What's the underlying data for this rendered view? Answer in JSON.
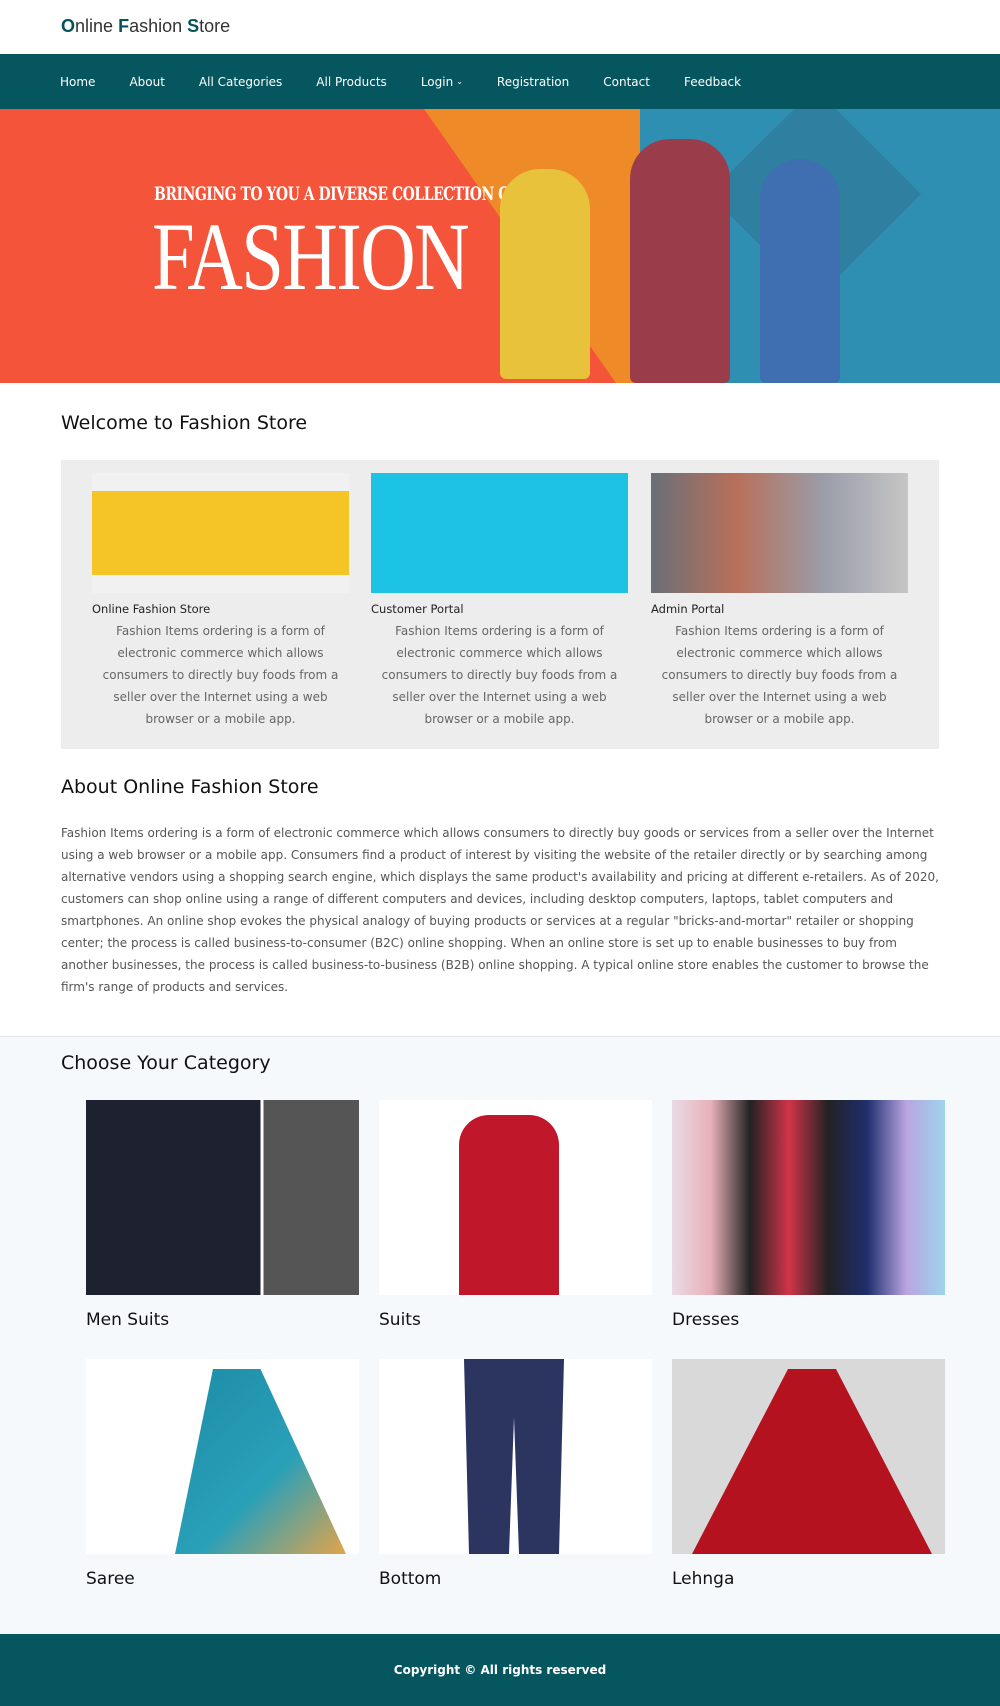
{
  "header": {
    "brand": "Online Fashion Store"
  },
  "nav": {
    "items": [
      "Home",
      "About",
      "All Categories",
      "All Products",
      "Login",
      "Registration",
      "Contact",
      "Feedback"
    ]
  },
  "banner": {
    "subtitle": "BRINGING TO YOU A DIVERSE COLLECTION OF",
    "title": "FASHION"
  },
  "welcome": {
    "heading": "Welcome to Fashion Store",
    "cards": [
      {
        "title": "Online Fashion Store",
        "text": "Fashion Items ordering is a form of electronic commerce which allows consumers to directly buy foods from a seller over the Internet using a web browser or a mobile app."
      },
      {
        "title": "Customer Portal",
        "text": "Fashion Items ordering is a form of electronic commerce which allows consumers to directly buy foods from a seller over the Internet using a web browser or a mobile app."
      },
      {
        "title": "Admin Portal",
        "text": "Fashion Items ordering is a form of electronic commerce which allows consumers to directly buy foods from a seller over the Internet using a web browser or a mobile app."
      }
    ]
  },
  "about": {
    "heading": "About Online Fashion Store",
    "text": "Fashion Items ordering is a form of electronic commerce which allows consumers to directly buy goods or services from a seller over the Internet using a web browser or a mobile app. Consumers find a product of interest by visiting the website of the retailer directly or by searching among alternative vendors using a shopping search engine, which displays the same product's availability and pricing at different e-retailers. As of 2020, customers can shop online using a range of different computers and devices, including desktop computers, laptops, tablet computers and smartphones. An online shop evokes the physical analogy of buying products or services at a regular \"bricks-and-mortar\" retailer or shopping center; the process is called business-to-consumer (B2C) online shopping. When an online store is set up to enable businesses to buy from another businesses, the process is called business-to-business (B2B) online shopping. A typical online store enables the customer to browse the firm's range of products and services."
  },
  "categories": {
    "heading": "Choose Your Category",
    "items": [
      "Men Suits",
      "Suits",
      "Dresses",
      "Saree",
      "Bottom",
      "Lehnga"
    ]
  },
  "footer": {
    "copyright": "Copyright © All rights reserved"
  },
  "colors": {
    "nav": "#05565f",
    "banner_orange": "#f4553a",
    "banner_blue": "#2e8fb3"
  }
}
